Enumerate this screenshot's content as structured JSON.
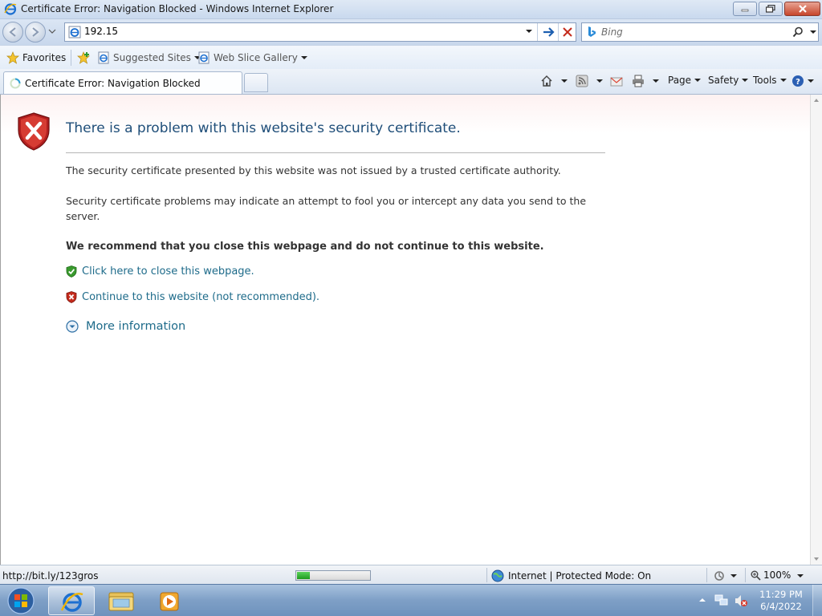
{
  "window": {
    "title": "Certificate Error: Navigation Blocked - Windows Internet Explorer"
  },
  "navbar": {
    "address_value": "192.15",
    "search_placeholder": "Bing"
  },
  "favorites_bar": {
    "favorites_label": "Favorites",
    "items": [
      {
        "label": "Suggested Sites",
        "icon": "ie-page-icon"
      },
      {
        "label": "Web Slice Gallery",
        "icon": "ie-page-icon"
      }
    ]
  },
  "tabs": [
    {
      "label": "Certificate Error: Navigation Blocked",
      "active": true
    }
  ],
  "command_bar": {
    "page_label": "Page",
    "safety_label": "Safety",
    "tools_label": "Tools"
  },
  "page": {
    "heading": "There is a problem with this website's security certificate.",
    "paragraph1": "The security certificate presented by this website was not issued by a trusted certificate authority.",
    "paragraph2": "Security certificate problems may indicate an attempt to fool you or intercept any data you send to the server.",
    "recommendation": "We recommend that you close this webpage and do not continue to this website.",
    "close_link": "Click here to close this webpage.",
    "continue_link": "Continue to this website (not recommended).",
    "more_info_link": "More information"
  },
  "status_bar": {
    "url": "http://bit.ly/123gros",
    "progress": 0.18,
    "zone_text": "Internet | Protected Mode: On",
    "zoom": "100%"
  },
  "taskbar": {
    "time": "11:29 PM",
    "date": "6/4/2022"
  },
  "colors": {
    "link": "#1e6b8a",
    "heading": "#1f4e79",
    "error_red": "#c42b1c",
    "safe_green": "#3a9a2e"
  }
}
